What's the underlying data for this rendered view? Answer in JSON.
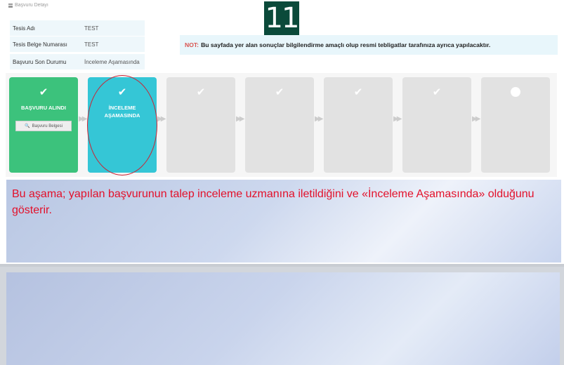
{
  "panel": {
    "title": "Başvuru Detayı"
  },
  "step_number": "11",
  "info": [
    {
      "key": "Tesis Adı",
      "value": "TEST"
    },
    {
      "key": "Tesis Belge Numarası",
      "value": "TEST"
    },
    {
      "key": "Başvuru Son Durumu",
      "value": "İnceleme Aşamasında"
    }
  ],
  "note": {
    "tag": "NOT:",
    "text": "Bu sayfada yer alan sonuçlar bilgilendirme amaçlı olup resmi tebligatlar tarafınıza ayrıca yapılacaktır."
  },
  "stages": [
    {
      "label": "BAŞVURU ALINDI",
      "state": "done",
      "color": "#3cc27c",
      "button": "Başvuru Belgesi"
    },
    {
      "label": "İNCELEME AŞAMASINDA",
      "state": "current",
      "color": "#35c6d6"
    },
    {
      "label": "",
      "state": "pending"
    },
    {
      "label": "",
      "state": "pending"
    },
    {
      "label": "",
      "state": "pending"
    },
    {
      "label": "",
      "state": "pending"
    },
    {
      "label": "",
      "state": "pending"
    }
  ],
  "explanation": "Bu aşama; yapılan başvurunun talep inceleme uzmanına iletildiğini ve «İnceleme Aşamasında» olduğunu gösterir.",
  "colors": {
    "accent_red": "#e3102a",
    "highlight_circle": "#cc2233"
  }
}
